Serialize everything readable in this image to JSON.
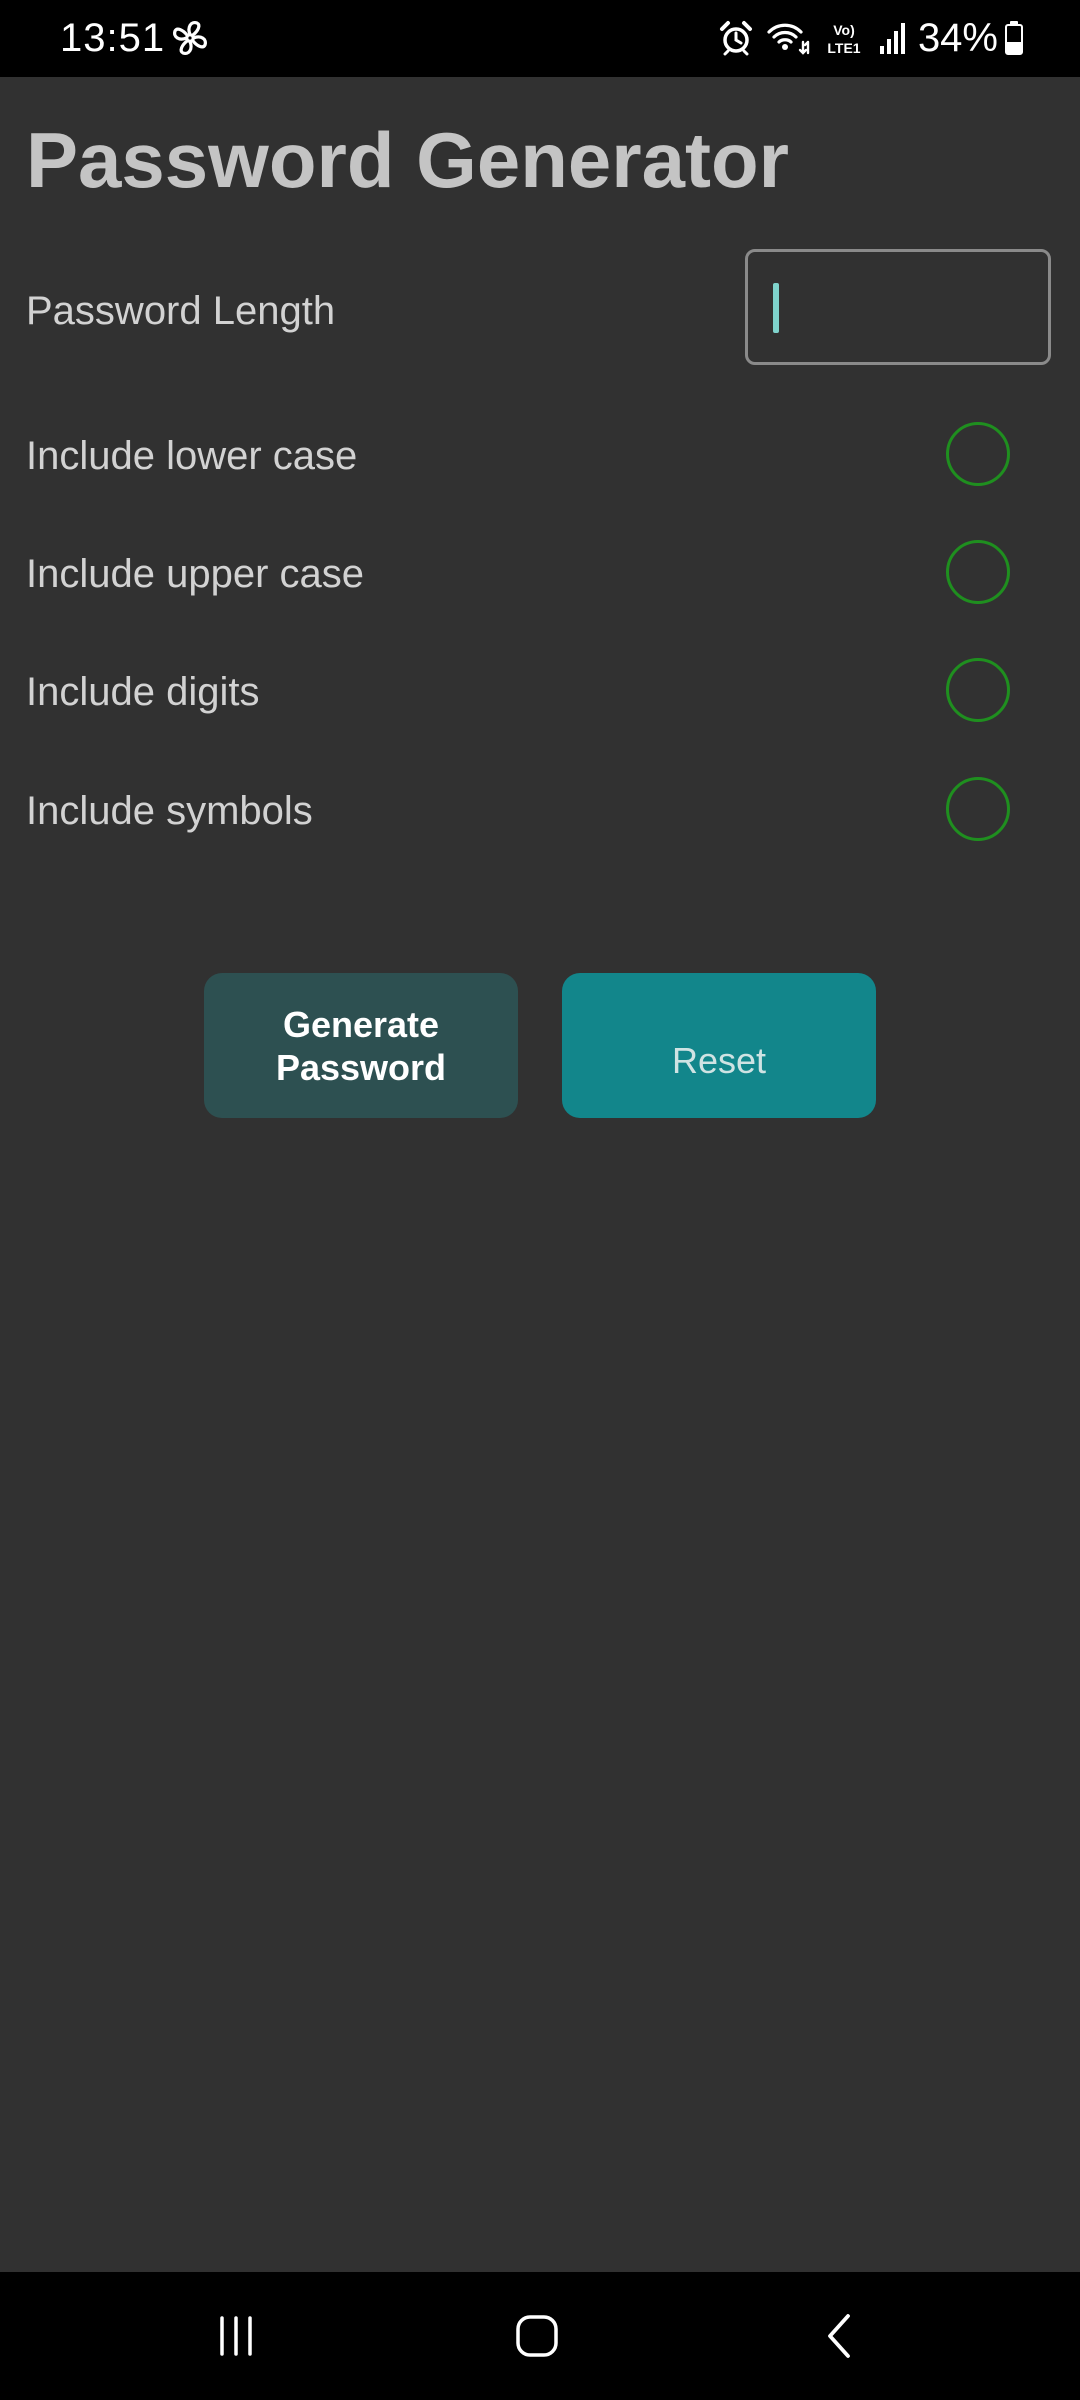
{
  "status_bar": {
    "time": "13:51",
    "battery_text": "34%",
    "network_label": "Vo) LTE1",
    "icons": [
      "fan-icon",
      "alarm-icon",
      "wifi-icon",
      "volte-icon",
      "signal-icon",
      "battery-icon"
    ]
  },
  "app": {
    "title": "Password Generator"
  },
  "form": {
    "length_label": "Password Length",
    "length_value": "",
    "options": [
      {
        "label": "Include lower case",
        "checked": false
      },
      {
        "label": "Include upper case",
        "checked": false
      },
      {
        "label": "Include digits",
        "checked": false
      },
      {
        "label": "Include symbols",
        "checked": false
      }
    ]
  },
  "buttons": {
    "generate_label": "Generate Password",
    "reset_label": "Reset"
  },
  "nav_bar": {
    "icons": [
      "recent-apps-icon",
      "home-icon",
      "back-icon"
    ]
  },
  "colors": {
    "background": "#313131",
    "bar_background": "#000000",
    "title_text": "#c4c4c4",
    "label_text": "#d2d2d2",
    "radio_border": "#1f8f1f",
    "generate_button": "#2d5051",
    "reset_button": "#12868b",
    "caret": "#7fd3cc"
  }
}
